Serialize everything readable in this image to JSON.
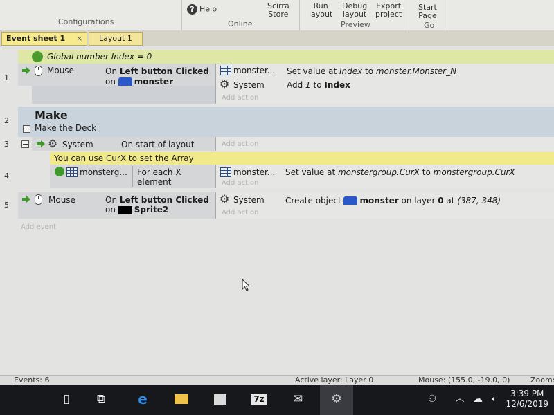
{
  "ribbon": {
    "configurations_label": "Configurations",
    "help_label": "Help",
    "online_label": "Online",
    "scirra_store_line1": "Scirra",
    "scirra_store_line2": "Store",
    "run_layout_line1": "Run",
    "run_layout_line2": "layout",
    "debug_layout_line1": "Debug",
    "debug_layout_line2": "layout",
    "export_project_line1": "Export",
    "export_project_line2": "project",
    "preview_label": "Preview",
    "start_page_line1": "Start",
    "start_page_line2": "Page",
    "go_label": "Go"
  },
  "tabs": [
    {
      "label": "Event sheet 1",
      "close": "×"
    },
    {
      "label": "Layout 1"
    }
  ],
  "global_var": "Global number Index = 0",
  "events": {
    "e1": {
      "num": "1",
      "object": "Mouse",
      "condition_line1_pre": "On ",
      "condition_line1_b": "Left button Clicked",
      "condition_line2_pre": "on ",
      "condition_line2_b": "monster",
      "action1_object": "monster...",
      "action1_text_pre": "Set value at ",
      "action1_text_it1": "Index",
      "action1_text_mid": " to ",
      "action1_text_it2": "monster.Monster_N",
      "action2_object": "System",
      "action2_text_pre": "Add ",
      "action2_text_it": "1",
      "action2_text_mid": " to ",
      "action2_text_b": "Index",
      "add_action": "Add action"
    },
    "e2": {
      "num": "2",
      "group_title": "Make",
      "group_desc": "Make the Deck"
    },
    "e3": {
      "num": "3",
      "object": "System",
      "condition": "On start of layout",
      "add_action": "Add action"
    },
    "comment": "You can use CurX to set the Array",
    "e4": {
      "num": "4",
      "object": "monsterg...",
      "condition_line1": "For each X",
      "condition_line2": "element",
      "action_object": "monster...",
      "action_text_pre": "Set value at ",
      "action_text_it1": "monstergroup.CurX",
      "action_text_mid": " to ",
      "action_text_it2": "monstergroup.CurX",
      "add_action": "Add action"
    },
    "e5": {
      "num": "5",
      "object": "Mouse",
      "condition_line1_pre": "On ",
      "condition_line1_b": "Left button Clicked",
      "condition_line2_pre": "on ",
      "condition_line2_b": "Sprite2",
      "action_object": "System",
      "action_text_pre": "Create object ",
      "action_text_b": "monster",
      "action_text_mid": " on layer ",
      "action_text_layer": "0",
      "action_text_post": " at ",
      "action_text_coords": "(387, 348)",
      "add_action": "Add action"
    },
    "add_event": "Add event"
  },
  "status": {
    "events": "Events: 6",
    "active_layer": "Active layer: Layer 0",
    "mouse": "Mouse: (155.0, -19.0, 0)",
    "zoom": "Zoom:"
  },
  "taskbar": {
    "time": "3:39 PM",
    "date": "12/6/2019"
  },
  "colors": {
    "global_var_bg": "#dfe7a6",
    "comment_bg": "#f1ea8a",
    "group_bg": "#c9d3dc",
    "tab_bg": "#f3e69a",
    "taskbar_bg": "#17181b",
    "arrow_green": "#3d9a2a"
  }
}
